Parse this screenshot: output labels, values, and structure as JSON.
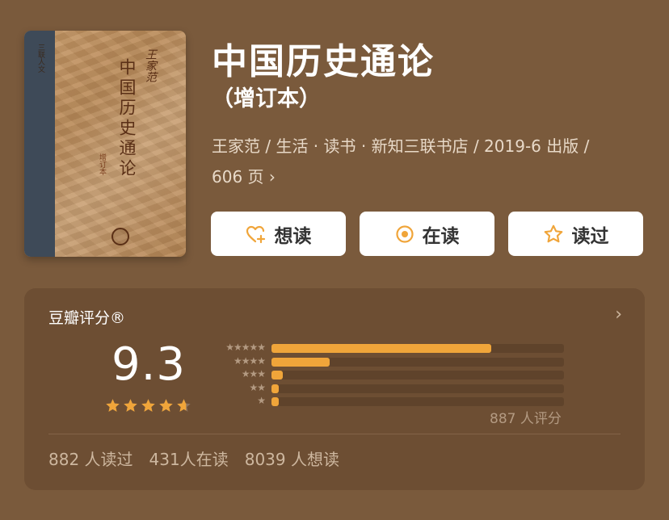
{
  "book": {
    "cover_title": "中国历史通论",
    "cover_author": "王家范",
    "cover_subtitle": "增订本",
    "cover_series": "三联人文",
    "title": "中国历史通论",
    "subtitle": "（增订本）",
    "meta_line1": "王家范 / 生活 · 读书 · 新知三联书店 / 2019-6 出版 /",
    "meta_line2": "606 页"
  },
  "actions": [
    {
      "label": "想读",
      "icon": "heart-plus-icon"
    },
    {
      "label": "在读",
      "icon": "circle-dot-icon"
    },
    {
      "label": "读过",
      "icon": "star-icon"
    }
  ],
  "rating": {
    "label": "豆瓣评分®",
    "score": "9.3",
    "stars": 4.65,
    "distribution": [
      {
        "stars": "★★★★★",
        "fraction": 0.75
      },
      {
        "stars": "★★★★",
        "fraction": 0.2
      },
      {
        "stars": "★★★",
        "fraction": 0.04
      },
      {
        "stars": "★★",
        "fraction": 0.025
      },
      {
        "stars": "★",
        "fraction": 0.025
      }
    ],
    "count": "887 人评分",
    "accent": "#f0a53a"
  },
  "stats": {
    "read": "882 人读过",
    "reading": "431人在读",
    "want": "8039 人想读"
  }
}
